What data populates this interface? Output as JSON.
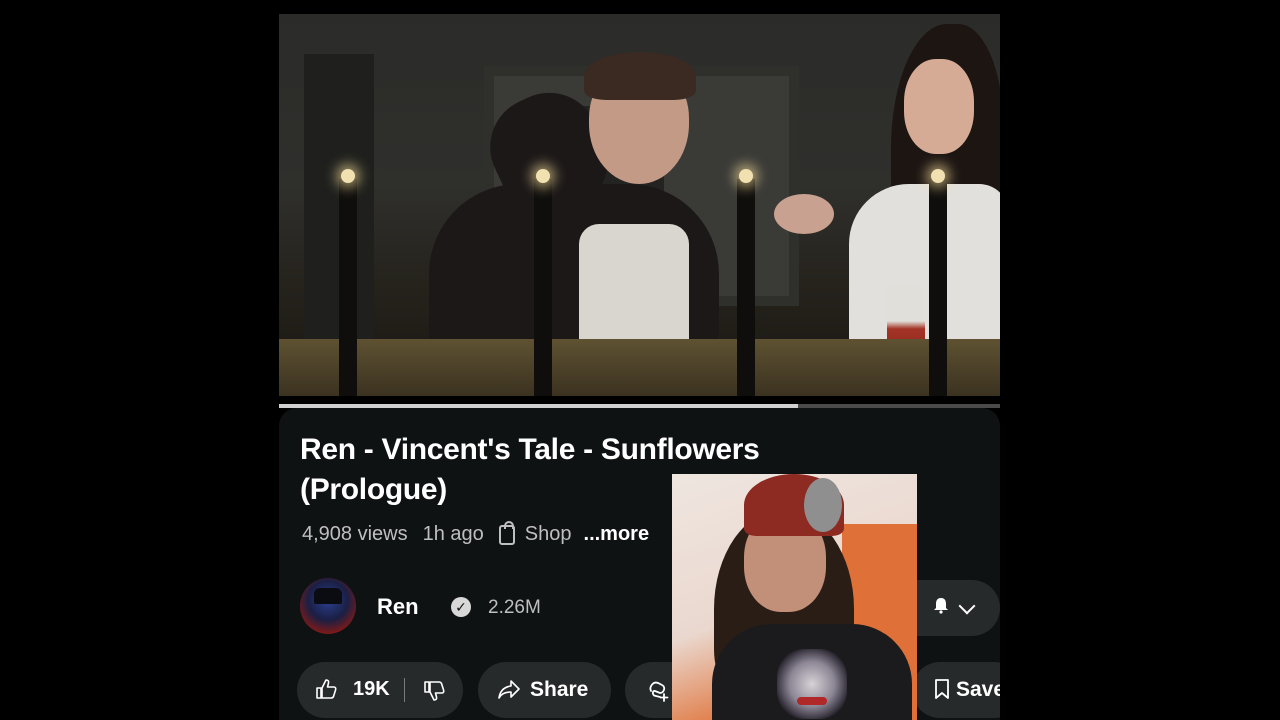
{
  "video": {
    "progress_fraction": 0.72
  },
  "info": {
    "title": "Ren - Vincent's Tale - Sunflowers (Prologue)",
    "views": "4,908 views",
    "age": "1h ago",
    "shop_label": "Shop",
    "more_label": "...more"
  },
  "channel": {
    "name": "Ren",
    "subscribers": "2.26M",
    "verified_mark": "✓"
  },
  "actions": {
    "like_count": "19K",
    "share_label": "Share",
    "save_label": "Save"
  },
  "icons": [
    "like-icon",
    "dislike-icon",
    "share-icon",
    "remix-icon",
    "save-icon",
    "bell-icon",
    "chevron-down-icon",
    "shop-icon",
    "verified-icon"
  ],
  "colors": {
    "background": "#000000",
    "panel": "#0f1212",
    "pill": "#272a2a",
    "muted_text": "#bfbfbf"
  }
}
